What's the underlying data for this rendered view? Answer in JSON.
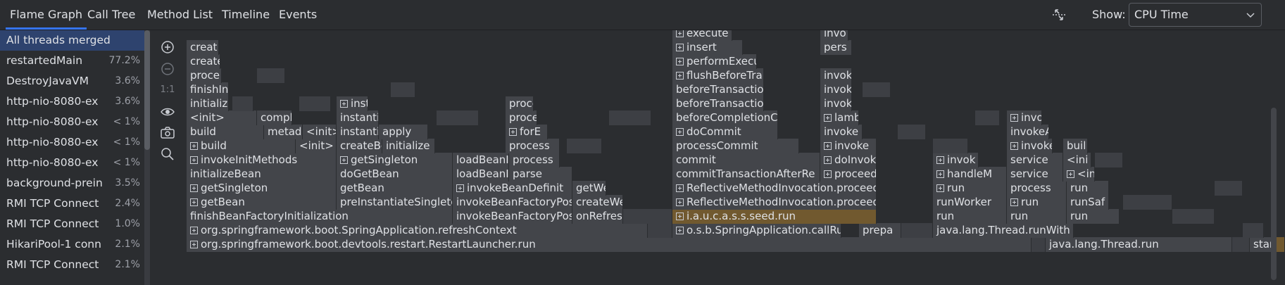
{
  "tabs": [
    {
      "label": "Flame Graph",
      "active": true
    },
    {
      "label": "Call Tree",
      "active": false
    },
    {
      "label": "Method List",
      "active": false
    },
    {
      "label": "Timeline",
      "active": false
    },
    {
      "label": "Events",
      "active": false
    }
  ],
  "show": {
    "label": "Show:",
    "value": "CPU Time"
  },
  "threads": [
    {
      "name": "All threads merged",
      "pct": "",
      "selected": true
    },
    {
      "name": "restartedMain",
      "pct": "77.2%"
    },
    {
      "name": "DestroyJavaVM",
      "pct": "3.6%"
    },
    {
      "name": "http-nio-8080-ex",
      "pct": "3.6%"
    },
    {
      "name": "http-nio-8080-ex",
      "pct": "< 1%"
    },
    {
      "name": "http-nio-8080-ex",
      "pct": "< 1%"
    },
    {
      "name": "http-nio-8080-ex",
      "pct": "< 1%"
    },
    {
      "name": "background-prein",
      "pct": "3.5%"
    },
    {
      "name": "RMI TCP Connect",
      "pct": "2.4%"
    },
    {
      "name": "RMI TCP Connect",
      "pct": "1.0%"
    },
    {
      "name": "HikariPool-1 conn",
      "pct": "2.1%"
    },
    {
      "name": "RMI TCP Connect",
      "pct": "2.1%"
    }
  ],
  "toolbar": {
    "zoom_reset_label": "1:1",
    "icons": [
      "zoom-in-icon",
      "zoom-out-icon",
      "eye-icon",
      "camera-icon",
      "search-icon"
    ]
  },
  "frames": [
    {
      "text": "org.springframework.boot.devtools.restart.RestartLauncher.run",
      "exp": true
    },
    {
      "text": "java.lang.Thread.run"
    },
    {
      "text": "star"
    },
    {
      "text": "org.springframework.boot.SpringApplication.refreshContext",
      "exp": true
    },
    {
      "text": "o.s.b.SpringApplication.callRunners",
      "exp": true
    },
    {
      "text": "prepa"
    },
    {
      "text": "java.lang.Thread.runWith"
    },
    {
      "text": "finishBeanFactoryInitialization"
    },
    {
      "text": "invokeBeanFactoryPostI"
    },
    {
      "text": "onRefresl"
    },
    {
      "text": "i.a.u.c.a.s.s.seed.run",
      "exp": true
    },
    {
      "text": "run"
    },
    {
      "text": "run"
    },
    {
      "text": "run"
    },
    {
      "text": "getBean",
      "exp": true
    },
    {
      "text": "preInstantiateSingletons"
    },
    {
      "text": "invokeBeanFactoryPostI"
    },
    {
      "text": "createWe"
    },
    {
      "text": "ReflectiveMethodInvocation.proceed",
      "exp": true
    },
    {
      "text": "runWorker"
    },
    {
      "text": "run",
      "exp": true
    },
    {
      "text": "runSaf"
    },
    {
      "text": "getSingleton",
      "exp": true
    },
    {
      "text": "getBean"
    },
    {
      "text": "invokeBeanDefinit",
      "exp": true
    },
    {
      "text": "getWe"
    },
    {
      "text": "ReflectiveMethodInvocation.proceed",
      "exp": true
    },
    {
      "text": "run",
      "exp": true
    },
    {
      "text": "process"
    },
    {
      "text": "run"
    },
    {
      "text": "initializeBean"
    },
    {
      "text": "doGetBean"
    },
    {
      "text": "loadBeanI"
    },
    {
      "text": "parse"
    },
    {
      "text": "commitTransactionAfterRe"
    },
    {
      "text": "proceed",
      "exp": true
    },
    {
      "text": "handleM",
      "exp": true
    },
    {
      "text": "service"
    },
    {
      "text": "<ini",
      "exp": true
    },
    {
      "text": "invokeInitMethods",
      "exp": true
    },
    {
      "text": "getSingleton",
      "exp": true
    },
    {
      "text": "loadBeanI"
    },
    {
      "text": "process"
    },
    {
      "text": "commit"
    },
    {
      "text": "doInvok",
      "exp": true
    },
    {
      "text": "invok",
      "exp": true
    },
    {
      "text": "service"
    },
    {
      "text": "<ini"
    },
    {
      "text": "build",
      "exp": true
    },
    {
      "text": "<init>"
    },
    {
      "text": "createBe"
    },
    {
      "text": "initialize"
    },
    {
      "text": "process"
    },
    {
      "text": "processCommit"
    },
    {
      "text": "invoke",
      "exp": true
    },
    {
      "text": "invoke",
      "exp": true
    },
    {
      "text": "buil"
    },
    {
      "text": "build"
    },
    {
      "text": "metad"
    },
    {
      "text": "<init>"
    },
    {
      "text": "instanti"
    },
    {
      "text": "apply"
    },
    {
      "text": "forE",
      "exp": true
    },
    {
      "text": "doCommit",
      "exp": true
    },
    {
      "text": "invoke"
    },
    {
      "text": "invokeA"
    },
    {
      "text": "<init>"
    },
    {
      "text": "comple"
    },
    {
      "text": "instanti"
    },
    {
      "text": "proce"
    },
    {
      "text": "beforeCompletionC"
    },
    {
      "text": "lamb",
      "exp": true
    },
    {
      "text": "invo",
      "exp": true
    },
    {
      "text": "initializ"
    },
    {
      "text": "inst",
      "exp": true
    },
    {
      "text": "proce"
    },
    {
      "text": "beforeTransactionC"
    },
    {
      "text": "invok"
    },
    {
      "text": "finishIn"
    },
    {
      "text": "beforeTransactionC"
    },
    {
      "text": "invok"
    },
    {
      "text": "proce"
    },
    {
      "text": "flushBeforeTrans",
      "exp": true
    },
    {
      "text": "invok"
    },
    {
      "text": "create"
    },
    {
      "text": "performExecu",
      "exp": true
    },
    {
      "text": "creat"
    },
    {
      "text": "insert",
      "exp": true
    },
    {
      "text": "pers"
    },
    {
      "text": "execute",
      "exp": true
    },
    {
      "text": "invo"
    }
  ]
}
